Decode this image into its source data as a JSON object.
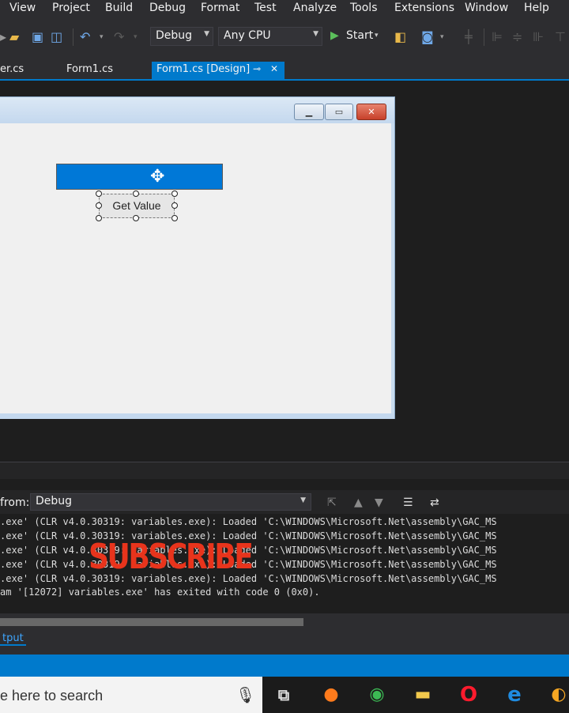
{
  "menu": {
    "items": [
      "View",
      "Project",
      "Build",
      "Debug",
      "Format",
      "Test",
      "Analyze",
      "Tools",
      "Extensions",
      "Window",
      "Help"
    ]
  },
  "toolbar": {
    "config_value": "Debug",
    "platform_value": "Any CPU",
    "start_label": "Start"
  },
  "tabs": {
    "items": [
      "er.cs",
      "Form1.cs",
      "Form1.cs [Design]"
    ],
    "active_pin": "⊸",
    "active_close": "✕"
  },
  "designer": {
    "button_label": "Get Value",
    "textbox_value": ""
  },
  "output": {
    "from_label": "from:",
    "from_value": "Debug",
    "lines": [
      ".exe' (CLR v4.0.30319: variables.exe): Loaded 'C:\\WINDOWS\\Microsoft.Net\\assembly\\GAC_MS",
      ".exe' (CLR v4.0.30319: variables.exe): Loaded 'C:\\WINDOWS\\Microsoft.Net\\assembly\\GAC_MS",
      ".exe' (CLR v4.0.30319: variables.exe): Loaded 'C:\\WINDOWS\\Microsoft.Net\\assembly\\GAC_MS",
      ".exe' (CLR v4.0.30319: variables.exe): Loaded 'C:\\WINDOWS\\Microsoft.Net\\assembly\\GAC_MS",
      ".exe' (CLR v4.0.30319: variables.exe): Loaded 'C:\\WINDOWS\\Microsoft.Net\\assembly\\GAC_MS",
      "am '[12072] variables.exe' has exited with code 0 (0x0)."
    ],
    "overlay_text": "SUBSCRIBE",
    "tab_label": "tput"
  },
  "taskbar": {
    "search_placeholder": "e here to search"
  },
  "colors": {
    "accent": "#007acc",
    "ide_bg": "#1e1e1e",
    "selection": "#0078d7",
    "overlay": "#e8341c"
  }
}
